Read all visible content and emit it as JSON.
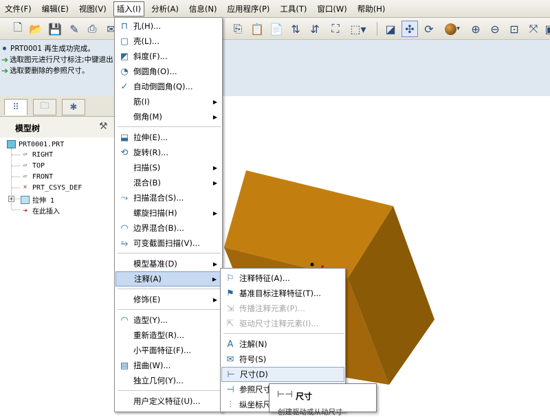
{
  "menubar": {
    "items": [
      "文件(F)",
      "编辑(E)",
      "视图(V)",
      "插入(I)",
      "分析(A)",
      "信息(N)",
      "应用程序(P)",
      "工具(T)",
      "窗口(W)",
      "帮助(H)"
    ],
    "active": "插入(I)"
  },
  "messages": [
    "PRT0001 再生成功完成。",
    "选取图元进行尺寸标注;中键退出",
    "选取要删除的参照尺寸。"
  ],
  "model_tree": {
    "title": "模型树",
    "nodes": [
      "PRT0001.PRT",
      "RIGHT",
      "TOP",
      "FRONT",
      "PRT_CSYS_DEF",
      "拉伸 1",
      "在此插入"
    ]
  },
  "insert_menu": {
    "items": [
      {
        "label": "孔(H)...",
        "icon": "hole-icon"
      },
      {
        "label": "壳(L)...",
        "icon": "shell-icon"
      },
      {
        "label": "斜度(F)...",
        "icon": "draft-icon"
      },
      {
        "label": "倒圆角(O)...",
        "icon": "round-icon"
      },
      {
        "label": "自动倒圆角(Q)...",
        "icon": "auto-round-icon"
      },
      {
        "label": "筋(I)",
        "icon": "",
        "submenu": true
      },
      {
        "label": "倒角(M)",
        "icon": "",
        "submenu": true
      },
      {
        "label": "拉伸(E)...",
        "icon": "extrude-icon"
      },
      {
        "label": "旋转(R)...",
        "icon": "revolve-icon"
      },
      {
        "label": "扫描(S)",
        "icon": "",
        "submenu": true
      },
      {
        "label": "混合(B)",
        "icon": "",
        "submenu": true
      },
      {
        "label": "扫描混合(S)...",
        "icon": "swept-blend-icon"
      },
      {
        "label": "螺旋扫描(H)",
        "icon": "",
        "submenu": true
      },
      {
        "label": "边界混合(B)...",
        "icon": "boundary-blend-icon"
      },
      {
        "label": "可变截面扫描(V)...",
        "icon": "variable-sweep-icon"
      },
      {
        "label": "模型基准(D)",
        "icon": "",
        "submenu": true
      },
      {
        "label": "注释(A)",
        "icon": "",
        "submenu": true,
        "highlighted": true
      },
      {
        "label": "修饰(E)",
        "icon": "",
        "submenu": true
      },
      {
        "label": "造型(Y)...",
        "icon": "style-icon"
      },
      {
        "label": "重新造型(R)...",
        "icon": ""
      },
      {
        "label": "小平面特征(F)...",
        "icon": ""
      },
      {
        "label": "扭曲(W)...",
        "icon": "warp-icon"
      },
      {
        "label": "独立几何(Y)...",
        "icon": ""
      },
      {
        "label": "用户定义特征(U)...",
        "icon": ""
      }
    ]
  },
  "annotation_menu": {
    "items": [
      {
        "label": "注释特征(A)...",
        "icon": "annotation-feature-icon"
      },
      {
        "label": "基准目标注释特征(T)...",
        "icon": "datum-target-icon"
      },
      {
        "label": "传播注释元素(P)...",
        "icon": "propagate-icon",
        "disabled": true
      },
      {
        "label": "驱动尺寸注释元素(I)...",
        "icon": "driven-dim-icon",
        "disabled": true
      },
      {
        "label": "注解(N)",
        "icon": "note-icon"
      },
      {
        "label": "符号(S)",
        "icon": "symbol-icon"
      },
      {
        "label": "尺寸(D)",
        "icon": "dimension-icon",
        "highlighted": true
      },
      {
        "label": "参照尺寸",
        "icon": "reference-dim-icon"
      },
      {
        "label": "纵坐标尺寸",
        "icon": "ordinate-dim-icon"
      }
    ]
  },
  "tooltip": {
    "title": "尺寸",
    "desc": "创建驱动或从动尺寸"
  },
  "colors": {
    "model_top": "#c27f10",
    "model_front": "#a2670a",
    "model_side": "#8a5a06",
    "menu_highlight": "#c8daf2"
  }
}
